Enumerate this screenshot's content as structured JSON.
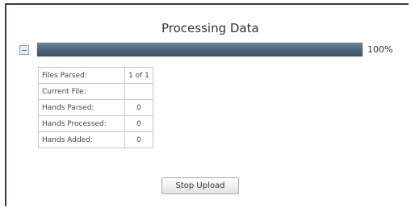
{
  "title": "Processing Data",
  "progress": {
    "percent_label": "100%",
    "fraction": 1.0
  },
  "stats": [
    {
      "label": "Files Parsed:",
      "value": "1 of 1"
    },
    {
      "label": "Current File:",
      "value": ""
    },
    {
      "label": "Hands Parsed:",
      "value": "0"
    },
    {
      "label": "Hands Processed:",
      "value": "0"
    },
    {
      "label": "Hands Added:",
      "value": "0"
    }
  ],
  "buttons": {
    "stop_label": "Stop Upload"
  },
  "icons": {
    "collapse": "collapse-minus-icon"
  },
  "colors": {
    "progress_fill": "#4b6176",
    "frame_border": "#2c3e50"
  }
}
